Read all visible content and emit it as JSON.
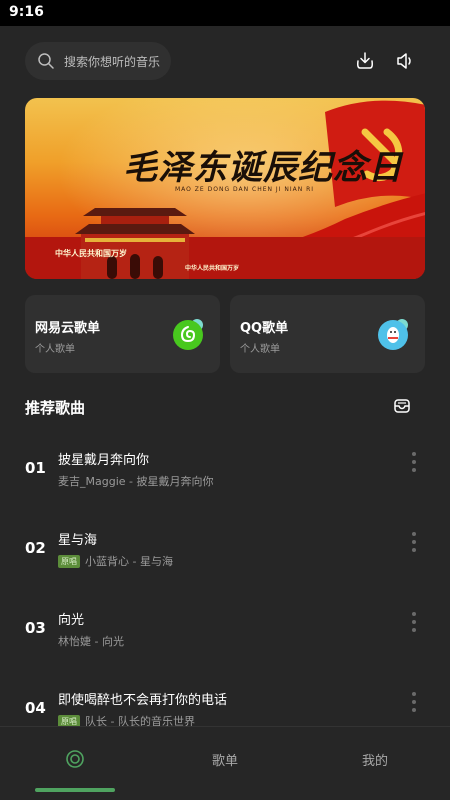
{
  "status_bar": {
    "time": "9:16"
  },
  "search": {
    "placeholder": "搜索你想听的音乐",
    "icon": "search-icon"
  },
  "header_icons": [
    "download-icon",
    "speaker-icon"
  ],
  "banner": {
    "title": "毛泽东诞辰纪念日",
    "subtitle": "MAO ZE DONG DAN CHEN JI NIAN RI",
    "slogans": [
      "中华人民共和国万岁",
      "中华人民共和国万岁"
    ]
  },
  "playlists": [
    {
      "title": "网易云歌单",
      "subtitle": "个人歌单",
      "icon": "netease-cloud-icon"
    },
    {
      "title": "QQ歌单",
      "subtitle": "个人歌单",
      "icon": "qq-penguin-icon"
    }
  ],
  "recommend": {
    "title": "推荐歌曲",
    "icon": "inbox-icon"
  },
  "songs": [
    {
      "num": "01",
      "title": "披星戴月奔向你",
      "tag": "",
      "subtitle": "麦吉_Maggie - 披星戴月奔向你"
    },
    {
      "num": "02",
      "title": "星与海",
      "tag": "原唱",
      "subtitle": "小蓝背心 - 星与海"
    },
    {
      "num": "03",
      "title": "向光",
      "tag": "",
      "subtitle": "林怡婕 - 向光"
    },
    {
      "num": "04",
      "title": "即使喝醉也不会再打你的电话",
      "tag": "原唱",
      "subtitle": "队长 - 队长的音乐世界"
    }
  ],
  "nav": {
    "items": [
      {
        "label": "",
        "icon": "target-icon"
      },
      {
        "label": "歌单"
      },
      {
        "label": "我的"
      }
    ],
    "accent": "#4fa360"
  },
  "colors": {
    "background": "#262626",
    "card": "#303030",
    "tag_green": "#5c8d3a"
  }
}
